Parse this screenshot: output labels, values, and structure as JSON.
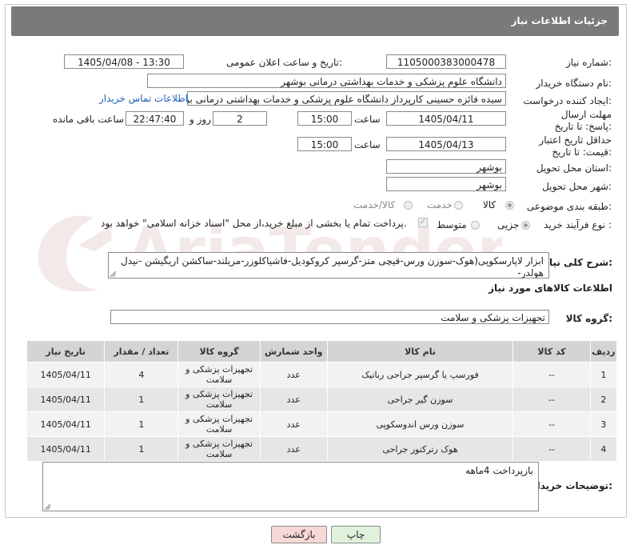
{
  "header": {
    "title": "جزئیات اطلاعات نیاز"
  },
  "fields": {
    "need_number": {
      "label": "شماره نیاز:",
      "value": "1105000383000478"
    },
    "announce_datetime": {
      "label": "تاریخ و ساعت اعلان عمومی:",
      "value": "1405/04/08 - 13:30"
    },
    "buyer_org": {
      "label": "نام دستگاه خریدار:",
      "value": "دانشگاه علوم پزشکی و خدمات بهداشتی درمانی بوشهر"
    },
    "requester": {
      "label": "ایجاد کننده درخواست:",
      "value": "سیده فائزه حسینی کارپرداز دانشگاه علوم پزشکی و خدمات بهداشتی درمانی بو",
      "contact_link": "اطلاعات تماس خریدار"
    },
    "send_deadline": {
      "label": "مهلت ارسال پاسخ: تا تاریخ:",
      "date": "1405/04/11",
      "time_label": "ساعت",
      "time": "15:00",
      "days": "2",
      "days_label": "روز و",
      "remaining": "22:47:40",
      "remaining_label": "ساعت باقی مانده"
    },
    "price_validity": {
      "label": "حداقل تاریخ اعتبار قیمت: تا تاریخ:",
      "date": "1405/04/13",
      "time_label": "ساعت",
      "time": "15:00"
    },
    "province": {
      "label": "استان محل تحویل:",
      "value": "بوشهر"
    },
    "city": {
      "label": "شهر محل تحویل:",
      "value": "بوشهر"
    },
    "category": {
      "label": "طبقه بندی موضوعی:",
      "options": [
        "کالا",
        "خدمت",
        "کالا/خدمت"
      ],
      "selected": "کالا"
    },
    "process_type": {
      "label": "نوع فرآیند خرید :",
      "options": [
        "جزیی",
        "متوسط"
      ],
      "selected": "جزیی",
      "note": "پرداخت تمام یا بخشی از مبلغ خرید،از محل \"اسناد خزانه اسلامی\" خواهد بود."
    }
  },
  "description": {
    "label": "شرح کلی نیاز:",
    "value": "ابزار لاپارسکوپی(هوک-سوزن ورس-قیچی متز-گرسپر کروکودیل-فاشیاکلوزر-مریلند-ساکشن اریگیشن -نیدل هولدر-"
  },
  "goods_info": {
    "title": "اطلاعات کالاهای مورد نیاز",
    "group_label": "گروه کالا:",
    "group_value": "تجهیزات پزشکی و سلامت"
  },
  "table": {
    "headers": [
      "ردیف",
      "کد کالا",
      "نام کالا",
      "واحد شمارش",
      "گروه کالا",
      "تعداد / مقدار",
      "تاریخ نیاز"
    ],
    "rows": [
      [
        "1",
        "--",
        "فورسپ یا گرسپر جراحی رباتیک",
        "عدد",
        "تجهیزات پزشکی و سلامت",
        "4",
        "1405/04/11"
      ],
      [
        "2",
        "--",
        "سوزن گیر جراحی",
        "عدد",
        "تجهیزات پزشکی و سلامت",
        "1",
        "1405/04/11"
      ],
      [
        "3",
        "--",
        "سوزن ورس اندوسکوپی",
        "عدد",
        "تجهیزات پزشکی و سلامت",
        "1",
        "1405/04/11"
      ],
      [
        "4",
        "--",
        "هوک رتركتور جراحی",
        "عدد",
        "تجهیزات پزشکی و سلامت",
        "1",
        "1405/04/11"
      ]
    ]
  },
  "buyer_notes": {
    "label": "توضیحات خریدار:",
    "value": "بازپرداخت 4ماهه"
  },
  "buttons": {
    "print": "چاپ",
    "back": "بازگشت"
  },
  "watermark": {
    "text": "AriaTender.neT"
  },
  "colors": {
    "header_bg": "#7a7a7a",
    "back_button_bg": "#f8d7d7",
    "print_button_bg": "#e0f2dc",
    "link": "#1f5fb8"
  }
}
